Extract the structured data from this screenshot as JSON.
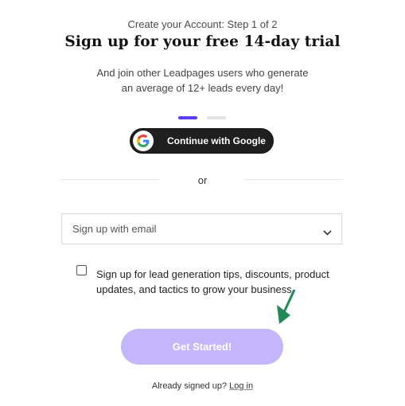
{
  "header": {
    "step_text": "Create your Account: Step 1 of 2",
    "title": "Sign up for your free 14-day trial",
    "subtitle_line1": "And join other Leadpages users who generate",
    "subtitle_line2": "an average of 12+ leads every day!"
  },
  "progress": {
    "current_step": 1,
    "total_steps": 2,
    "active_color": "#5b3df5",
    "inactive_color": "#e3e3e3"
  },
  "google": {
    "label": "Continue with Google",
    "icon": "google-g-icon"
  },
  "divider": {
    "text": "or"
  },
  "email": {
    "placeholder": "Sign up with email",
    "icon": "chevron-down-icon"
  },
  "optin": {
    "checked": false,
    "line1": "Sign up for lead generation tips, discounts, product",
    "line2": "updates, and tactics to grow your business"
  },
  "annotation": {
    "icon": "green-arrow-icon",
    "color": "#1f8a57"
  },
  "cta": {
    "label": "Get Started!",
    "color": "#c4b6fd"
  },
  "footer": {
    "prompt": "Already signed up?",
    "login_label": "Log in"
  }
}
